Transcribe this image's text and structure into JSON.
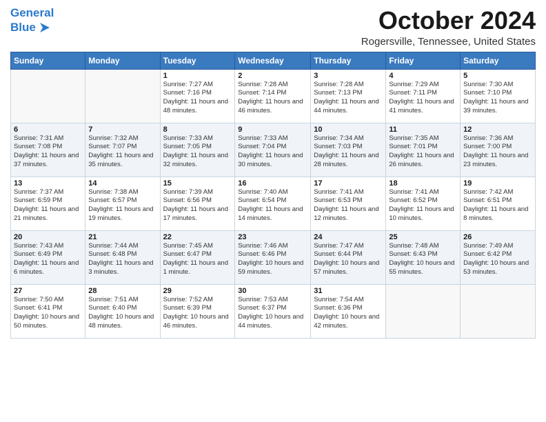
{
  "header": {
    "logo_line1": "General",
    "logo_line2": "Blue",
    "month_title": "October 2024",
    "location": "Rogersville, Tennessee, United States"
  },
  "days_of_week": [
    "Sunday",
    "Monday",
    "Tuesday",
    "Wednesday",
    "Thursday",
    "Friday",
    "Saturday"
  ],
  "weeks": [
    [
      {
        "day": "",
        "sunrise": "",
        "sunset": "",
        "daylight": ""
      },
      {
        "day": "",
        "sunrise": "",
        "sunset": "",
        "daylight": ""
      },
      {
        "day": "1",
        "sunrise": "Sunrise: 7:27 AM",
        "sunset": "Sunset: 7:16 PM",
        "daylight": "Daylight: 11 hours and 48 minutes."
      },
      {
        "day": "2",
        "sunrise": "Sunrise: 7:28 AM",
        "sunset": "Sunset: 7:14 PM",
        "daylight": "Daylight: 11 hours and 46 minutes."
      },
      {
        "day": "3",
        "sunrise": "Sunrise: 7:28 AM",
        "sunset": "Sunset: 7:13 PM",
        "daylight": "Daylight: 11 hours and 44 minutes."
      },
      {
        "day": "4",
        "sunrise": "Sunrise: 7:29 AM",
        "sunset": "Sunset: 7:11 PM",
        "daylight": "Daylight: 11 hours and 41 minutes."
      },
      {
        "day": "5",
        "sunrise": "Sunrise: 7:30 AM",
        "sunset": "Sunset: 7:10 PM",
        "daylight": "Daylight: 11 hours and 39 minutes."
      }
    ],
    [
      {
        "day": "6",
        "sunrise": "Sunrise: 7:31 AM",
        "sunset": "Sunset: 7:08 PM",
        "daylight": "Daylight: 11 hours and 37 minutes."
      },
      {
        "day": "7",
        "sunrise": "Sunrise: 7:32 AM",
        "sunset": "Sunset: 7:07 PM",
        "daylight": "Daylight: 11 hours and 35 minutes."
      },
      {
        "day": "8",
        "sunrise": "Sunrise: 7:33 AM",
        "sunset": "Sunset: 7:05 PM",
        "daylight": "Daylight: 11 hours and 32 minutes."
      },
      {
        "day": "9",
        "sunrise": "Sunrise: 7:33 AM",
        "sunset": "Sunset: 7:04 PM",
        "daylight": "Daylight: 11 hours and 30 minutes."
      },
      {
        "day": "10",
        "sunrise": "Sunrise: 7:34 AM",
        "sunset": "Sunset: 7:03 PM",
        "daylight": "Daylight: 11 hours and 28 minutes."
      },
      {
        "day": "11",
        "sunrise": "Sunrise: 7:35 AM",
        "sunset": "Sunset: 7:01 PM",
        "daylight": "Daylight: 11 hours and 26 minutes."
      },
      {
        "day": "12",
        "sunrise": "Sunrise: 7:36 AM",
        "sunset": "Sunset: 7:00 PM",
        "daylight": "Daylight: 11 hours and 23 minutes."
      }
    ],
    [
      {
        "day": "13",
        "sunrise": "Sunrise: 7:37 AM",
        "sunset": "Sunset: 6:59 PM",
        "daylight": "Daylight: 11 hours and 21 minutes."
      },
      {
        "day": "14",
        "sunrise": "Sunrise: 7:38 AM",
        "sunset": "Sunset: 6:57 PM",
        "daylight": "Daylight: 11 hours and 19 minutes."
      },
      {
        "day": "15",
        "sunrise": "Sunrise: 7:39 AM",
        "sunset": "Sunset: 6:56 PM",
        "daylight": "Daylight: 11 hours and 17 minutes."
      },
      {
        "day": "16",
        "sunrise": "Sunrise: 7:40 AM",
        "sunset": "Sunset: 6:54 PM",
        "daylight": "Daylight: 11 hours and 14 minutes."
      },
      {
        "day": "17",
        "sunrise": "Sunrise: 7:41 AM",
        "sunset": "Sunset: 6:53 PM",
        "daylight": "Daylight: 11 hours and 12 minutes."
      },
      {
        "day": "18",
        "sunrise": "Sunrise: 7:41 AM",
        "sunset": "Sunset: 6:52 PM",
        "daylight": "Daylight: 11 hours and 10 minutes."
      },
      {
        "day": "19",
        "sunrise": "Sunrise: 7:42 AM",
        "sunset": "Sunset: 6:51 PM",
        "daylight": "Daylight: 11 hours and 8 minutes."
      }
    ],
    [
      {
        "day": "20",
        "sunrise": "Sunrise: 7:43 AM",
        "sunset": "Sunset: 6:49 PM",
        "daylight": "Daylight: 11 hours and 6 minutes."
      },
      {
        "day": "21",
        "sunrise": "Sunrise: 7:44 AM",
        "sunset": "Sunset: 6:48 PM",
        "daylight": "Daylight: 11 hours and 3 minutes."
      },
      {
        "day": "22",
        "sunrise": "Sunrise: 7:45 AM",
        "sunset": "Sunset: 6:47 PM",
        "daylight": "Daylight: 11 hours and 1 minute."
      },
      {
        "day": "23",
        "sunrise": "Sunrise: 7:46 AM",
        "sunset": "Sunset: 6:46 PM",
        "daylight": "Daylight: 10 hours and 59 minutes."
      },
      {
        "day": "24",
        "sunrise": "Sunrise: 7:47 AM",
        "sunset": "Sunset: 6:44 PM",
        "daylight": "Daylight: 10 hours and 57 minutes."
      },
      {
        "day": "25",
        "sunrise": "Sunrise: 7:48 AM",
        "sunset": "Sunset: 6:43 PM",
        "daylight": "Daylight: 10 hours and 55 minutes."
      },
      {
        "day": "26",
        "sunrise": "Sunrise: 7:49 AM",
        "sunset": "Sunset: 6:42 PM",
        "daylight": "Daylight: 10 hours and 53 minutes."
      }
    ],
    [
      {
        "day": "27",
        "sunrise": "Sunrise: 7:50 AM",
        "sunset": "Sunset: 6:41 PM",
        "daylight": "Daylight: 10 hours and 50 minutes."
      },
      {
        "day": "28",
        "sunrise": "Sunrise: 7:51 AM",
        "sunset": "Sunset: 6:40 PM",
        "daylight": "Daylight: 10 hours and 48 minutes."
      },
      {
        "day": "29",
        "sunrise": "Sunrise: 7:52 AM",
        "sunset": "Sunset: 6:39 PM",
        "daylight": "Daylight: 10 hours and 46 minutes."
      },
      {
        "day": "30",
        "sunrise": "Sunrise: 7:53 AM",
        "sunset": "Sunset: 6:37 PM",
        "daylight": "Daylight: 10 hours and 44 minutes."
      },
      {
        "day": "31",
        "sunrise": "Sunrise: 7:54 AM",
        "sunset": "Sunset: 6:36 PM",
        "daylight": "Daylight: 10 hours and 42 minutes."
      },
      {
        "day": "",
        "sunrise": "",
        "sunset": "",
        "daylight": ""
      },
      {
        "day": "",
        "sunrise": "",
        "sunset": "",
        "daylight": ""
      }
    ]
  ]
}
